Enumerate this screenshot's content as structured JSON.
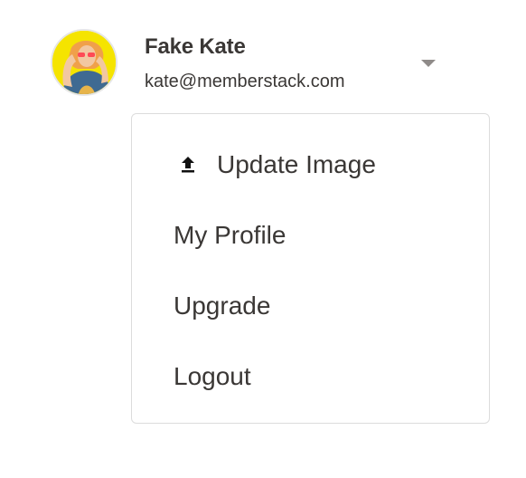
{
  "user": {
    "name": "Fake Kate",
    "email": "kate@memberstack.com"
  },
  "icons": {
    "avatar": "avatar",
    "dropdown": "caret-down-icon",
    "upload": "upload-icon"
  },
  "menu": {
    "items": [
      {
        "label": "Update Image",
        "icon": "upload-icon"
      },
      {
        "label": "My Profile"
      },
      {
        "label": "Upgrade"
      },
      {
        "label": "Logout"
      }
    ]
  },
  "colors": {
    "text": "#3a3735",
    "border": "#dcdcdc",
    "caret": "#8f8b89",
    "avatar_bg": "#f5e400"
  }
}
